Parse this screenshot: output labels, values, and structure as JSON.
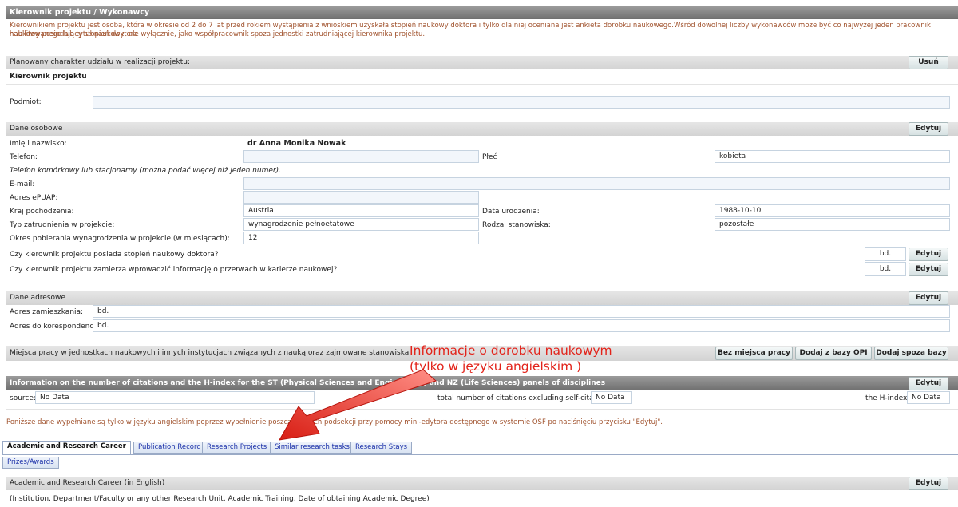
{
  "section": {
    "title": "Kierownik projektu / Wykonawcy",
    "note_line1": "Kierownikiem projektu jest osoba, która w okresie od 2 do 7 lat przed rokiem wystąpienia z wnioskiem uzyskała stopień naukowy doktora i tylko dla niej oceniana jest ankieta dorobku naukowego.Wśród dowolnej liczby wykonawców może być co najwyżej jeden pracownik naukowy posiadający stopień doktora",
    "note_line2": "habilitowanego lub tytuł naukowy, ale wyłącznie, jako współpracownik spoza jednostki zatrudniającej kierownika projektu."
  },
  "role": {
    "label": "Planowany charakter udziału w realizacji projektu:",
    "value": "Kierownik projektu",
    "remove_button": "Usuń"
  },
  "podmiot": {
    "label": "Podmiot:",
    "value": ""
  },
  "personal": {
    "band": "Dane osobowe",
    "edit_button": "Edytuj",
    "name_label": "Imię i nazwisko:",
    "name_value": "dr Anna Monika Nowak",
    "phone_label": "Telefon:",
    "phone_value": "",
    "sex_label": "Płeć",
    "sex_value": "kobieta",
    "phone_hint": "Telefon komórkowy lub stacjonarny (można podać więcej niż jeden numer).",
    "email_label": "E-mail:",
    "email_value": "",
    "epuap_label": "Adres ePUAP:",
    "epuap_value": "",
    "country_label": "Kraj pochodzenia:",
    "country_value": "Austria",
    "birth_label": "Data urodzenia:",
    "birth_value": "1988-10-10",
    "employment_label": "Typ zatrudnienia w projekcie:",
    "employment_value": "wynagrodzenie pełnoetatowe",
    "position_label": "Rodzaj stanowiska:",
    "position_value": "pozostałe",
    "period_label": "Okres pobierania wynagrodzenia w projekcie (w miesiącach):",
    "period_value": "12",
    "phd_question": "Czy kierownik projektu posiada stopień naukowy doktora?",
    "phd_value": "bd.",
    "phd_edit": "Edytuj",
    "break_question": "Czy kierownik projektu zamierza wprowadzić informację o przerwach w karierze naukowej?",
    "break_value": "bd.",
    "break_edit": "Edytuj"
  },
  "address": {
    "band": "Dane adresowe",
    "edit_button": "Edytuj",
    "home_label": "Adres zamieszkania:",
    "home_value": "bd.",
    "corr_label": "Adres do korespondencji:",
    "corr_value": "bd."
  },
  "work": {
    "band": "Miejsca pracy w jednostkach naukowych i innych instytucjach związanych z nauką oraz zajmowane stanowiska",
    "btn_none": "Bez miejsca pracy",
    "btn_opi": "Dodaj z bazy OPI",
    "btn_outside": "Dodaj spoza bazy"
  },
  "citations": {
    "header": "Information on the number of citations and the H-index for the ST (Physical Sciences and Engineering) and NZ (Life Sciences) panels of disciplines",
    "edit_button": "Edytuj",
    "source_label": "source:",
    "source_value": "No Data",
    "total_label": "total number of citations excluding self-citations:",
    "total_value": "No Data",
    "hindex_label": "the H-index:",
    "hindex_value": "No Data"
  },
  "english_note": "Poniższe dane wypełniane są tylko w języku angielskim poprzez wypełnienie poszczególnych podsekcji przy pomocy mini-edytora dostępnego w systemie OSF po naciśnięciu przycisku \"Edytuj\".",
  "tabs": [
    {
      "label": "Academic and Research Career"
    },
    {
      "label": "Publication Record"
    },
    {
      "label": "Research Projects"
    },
    {
      "label": "Similar research tasks"
    },
    {
      "label": "Research Stays"
    },
    {
      "label": "Prizes/Awards"
    }
  ],
  "career": {
    "band": "Academic and Research Career (in English)",
    "edit_button": "Edytuj",
    "hint": "(Institution, Department/Faculty or any other Research Unit, Academic Training, Date of obtaining Academic Degree)"
  },
  "annotation": {
    "line1": "Informacje o dorobku naukowym",
    "line2": "(tylko w języku angielskim )",
    "color": "#e2231a"
  }
}
